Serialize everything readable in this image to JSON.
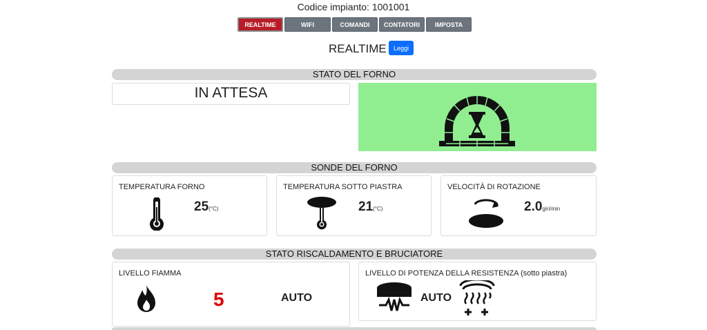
{
  "header": {
    "plant_label": "Codice impianto: 1001001"
  },
  "tabs": [
    {
      "label": "REALTIME",
      "active": true
    },
    {
      "label": "WIFI",
      "active": false
    },
    {
      "label": "COMANDI",
      "active": false
    },
    {
      "label": "CONTATORI",
      "active": false
    },
    {
      "label": "IMPOSTA",
      "active": false
    }
  ],
  "page": {
    "title": "REALTIME",
    "read_button": "Leggi"
  },
  "oven_state": {
    "section_title": "STATO DEL FORNO",
    "status": "IN ATTESA",
    "status_icon": "oven-hourglass-icon",
    "status_color": "#90ee90"
  },
  "probes": {
    "section_title": "SONDE DEL FORNO",
    "oven_temp": {
      "label": "TEMPERATURA FORNO",
      "value": "25",
      "unit": "(°C)",
      "icon": "thermometer-icon"
    },
    "plate_temp": {
      "label": "TEMPERATURA SOTTO PIASTRA",
      "value": "21",
      "unit": "(°C)",
      "icon": "plate-thermometer-icon"
    },
    "rotation": {
      "label": "VELOCITÀ DI ROTAZIONE",
      "value": "2.0",
      "unit": "giri/min",
      "icon": "rotation-plate-icon"
    }
  },
  "heating": {
    "section_title": "STATO RISCALDAMENTO E BRUCIATORE",
    "flame": {
      "label": "LIVELLO FIAMMA",
      "value": "5",
      "mode": "AUTO",
      "icon": "flame-icon",
      "value_color": "#e00000"
    },
    "resistance": {
      "label": "LIVELLO DI POTENZA DELLA RESISTENZA (sotto piastra)",
      "mode": "AUTO",
      "icon": "heating-element-icon",
      "level_icon": "heat-level-plus-plus-icon"
    }
  }
}
